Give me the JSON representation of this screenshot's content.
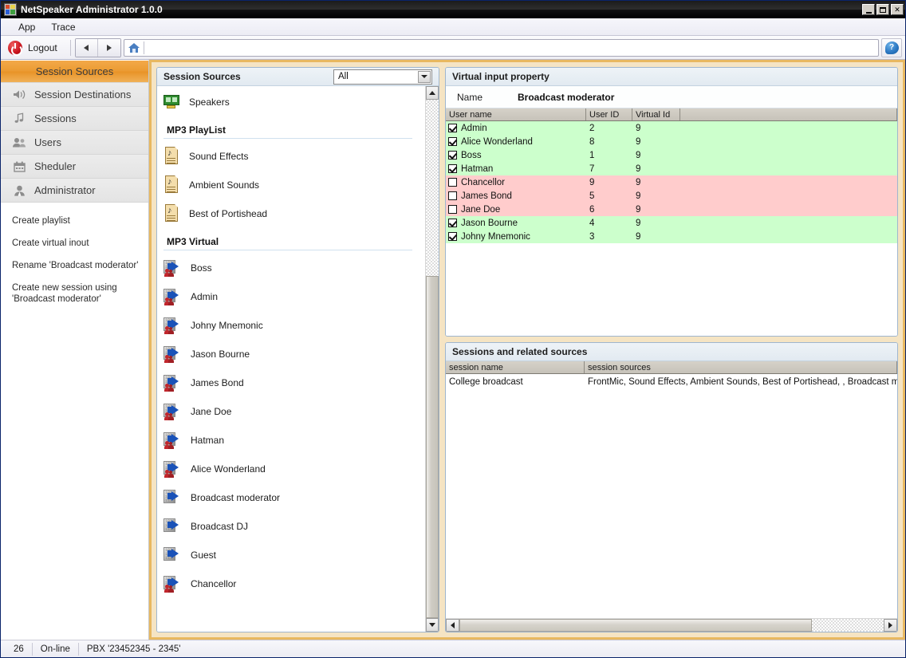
{
  "window": {
    "title": "NetSpeaker Administrator 1.0.0",
    "minimize_label": "Minimize",
    "maximize_label": "Maximize",
    "close_label": "✕"
  },
  "menu": {
    "items": [
      {
        "label": "App"
      },
      {
        "label": "Trace"
      }
    ]
  },
  "toolbar": {
    "logout_label": "Logout",
    "back_label": "Back",
    "forward_label": "Forward",
    "address_value": "",
    "address_placeholder": "",
    "help_label": "?"
  },
  "sidebar": {
    "active_tab": "Session Sources",
    "items": [
      {
        "label": "Session Destinations",
        "icon": "speaker-icon"
      },
      {
        "label": "Sessions",
        "icon": "music-note-icon"
      },
      {
        "label": "Users",
        "icon": "people-icon"
      },
      {
        "label": "Sheduler",
        "icon": "calendar-icon"
      },
      {
        "label": "Administrator",
        "icon": "person-icon"
      }
    ],
    "links": [
      {
        "label": "Create playlist"
      },
      {
        "label": "Create virtual inout"
      },
      {
        "label": "Rename 'Broadcast moderator'"
      },
      {
        "label": "Create new session using 'Broadcast moderator'"
      }
    ]
  },
  "sources": {
    "title": "Session Sources",
    "filter_value": "All",
    "top_items": [
      {
        "label": "Speakers",
        "icon": "sound-card-icon"
      }
    ],
    "groups": [
      {
        "title": "MP3 PlayList",
        "items": [
          {
            "label": "Sound Effects",
            "icon": "music-document-icon"
          },
          {
            "label": "Ambient Sounds",
            "icon": "music-document-icon"
          },
          {
            "label": "Best of Portishead",
            "icon": "music-document-icon"
          }
        ]
      },
      {
        "title": "MP3 Virtual",
        "items": [
          {
            "label": "Boss",
            "icon": "virtual-user-icon",
            "has_user": true
          },
          {
            "label": "Admin",
            "icon": "virtual-user-icon",
            "has_user": true
          },
          {
            "label": "Johny Mnemonic",
            "icon": "virtual-user-icon",
            "has_user": true
          },
          {
            "label": "Jason Bourne",
            "icon": "virtual-user-icon",
            "has_user": true
          },
          {
            "label": "James Bond",
            "icon": "virtual-user-icon",
            "has_user": true
          },
          {
            "label": "Jane Doe",
            "icon": "virtual-user-icon",
            "has_user": true
          },
          {
            "label": "Hatman",
            "icon": "virtual-user-icon",
            "has_user": true
          },
          {
            "label": "Alice Wonderland",
            "icon": "virtual-user-icon",
            "has_user": true
          },
          {
            "label": "Broadcast moderator",
            "icon": "virtual-input-icon",
            "has_user": false
          },
          {
            "label": "Broadcast DJ",
            "icon": "virtual-input-icon",
            "has_user": false
          },
          {
            "label": "Guest",
            "icon": "virtual-input-icon",
            "has_user": false
          },
          {
            "label": "Chancellor",
            "icon": "virtual-user-icon",
            "has_user": true
          }
        ]
      }
    ]
  },
  "virtual_input": {
    "title": "Virtual input property",
    "name_label": "Name",
    "name_value": "Broadcast moderator",
    "columns": [
      "User name",
      "User ID",
      "Virtual Id",
      ""
    ],
    "rows": [
      {
        "checked": true,
        "user_name": "Admin",
        "user_id": "2",
        "virtual_id": "9",
        "state": "green"
      },
      {
        "checked": true,
        "user_name": "Alice Wonderland",
        "user_id": "8",
        "virtual_id": "9",
        "state": "green"
      },
      {
        "checked": true,
        "user_name": "Boss",
        "user_id": "1",
        "virtual_id": "9",
        "state": "green"
      },
      {
        "checked": true,
        "user_name": "Hatman",
        "user_id": "7",
        "virtual_id": "9",
        "state": "green"
      },
      {
        "checked": false,
        "user_name": "Chancellor",
        "user_id": "9",
        "virtual_id": "9",
        "state": "pink"
      },
      {
        "checked": false,
        "user_name": "James Bond",
        "user_id": "5",
        "virtual_id": "9",
        "state": "pink"
      },
      {
        "checked": false,
        "user_name": "Jane Doe",
        "user_id": "6",
        "virtual_id": "9",
        "state": "pink"
      },
      {
        "checked": true,
        "user_name": "Jason Bourne",
        "user_id": "4",
        "virtual_id": "9",
        "state": "green"
      },
      {
        "checked": true,
        "user_name": "Johny Mnemonic",
        "user_id": "3",
        "virtual_id": "9",
        "state": "green"
      }
    ]
  },
  "sessions": {
    "title": "Sessions and related sources",
    "columns": [
      "session name",
      "session sources"
    ],
    "rows": [
      {
        "session_name": "College broadcast",
        "session_sources": "FrontMic, Sound Effects, Ambient Sounds, Best of Portishead, , Broadcast moderator"
      }
    ]
  },
  "statusbar": {
    "count": "26",
    "connection": "On-line",
    "pbx": "PBX '23452345 - 2345'"
  },
  "colors": {
    "accent_orange": "#eb9b33",
    "row_green": "#ccffcc",
    "row_pink": "#ffcccc",
    "panel_border": "#9fb6cf"
  }
}
